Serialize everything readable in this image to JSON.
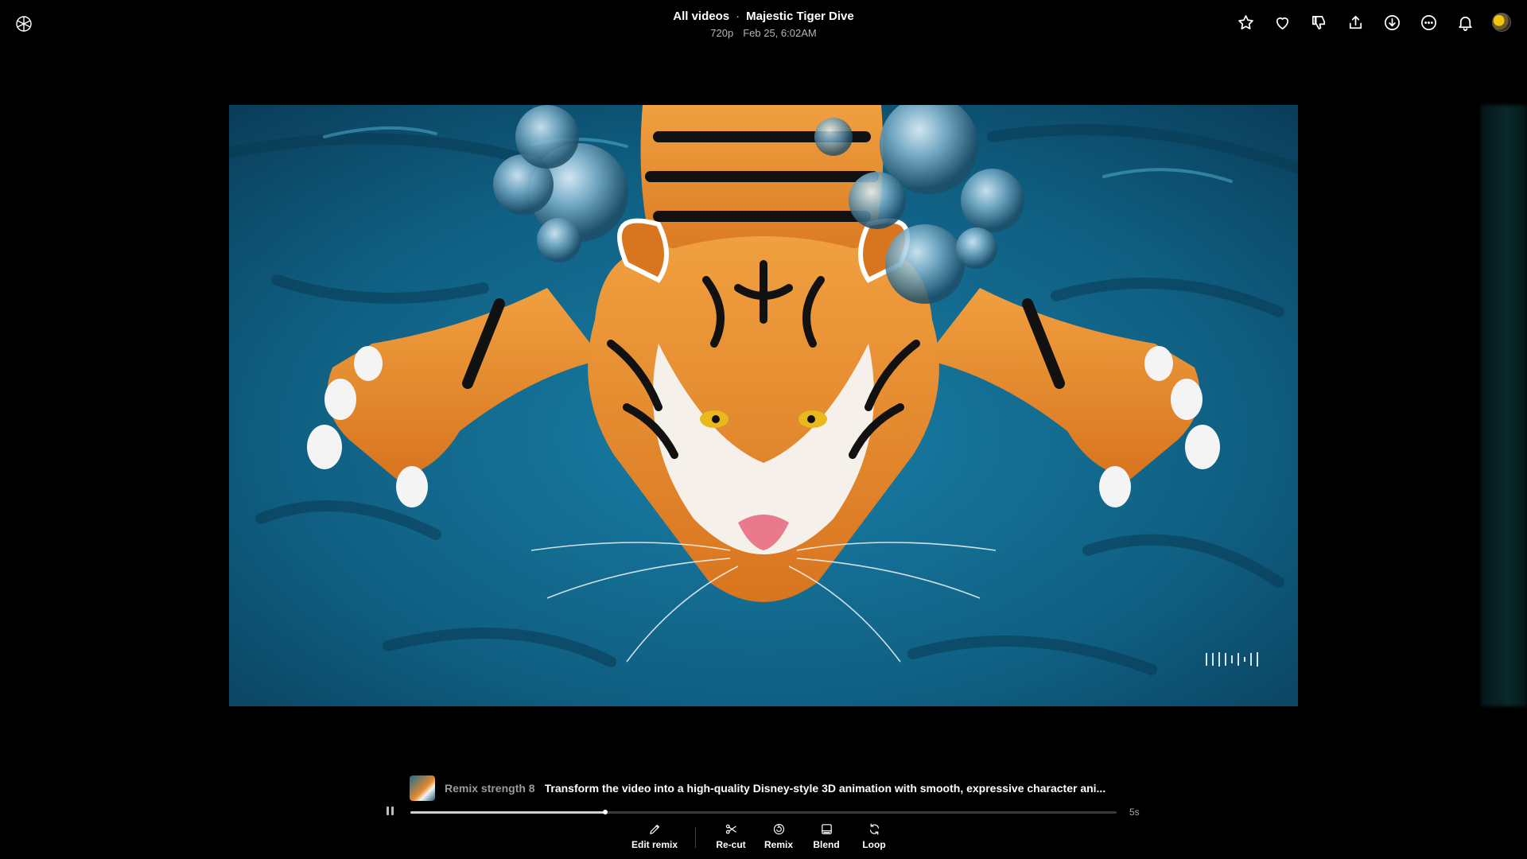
{
  "header": {
    "breadcrumb_root": "All videos",
    "separator": "·",
    "title": "Majestic Tiger Dive",
    "resolution": "720p",
    "timestamp": "Feb 25, 6:02AM"
  },
  "top_actions": [
    {
      "name": "favorite-star-icon"
    },
    {
      "name": "like-heart-icon"
    },
    {
      "name": "dislike-icon"
    },
    {
      "name": "share-icon"
    },
    {
      "name": "download-icon"
    },
    {
      "name": "more-options-icon"
    },
    {
      "name": "notifications-bell-icon"
    }
  ],
  "prompt": {
    "strength_label": "Remix strength 8",
    "text": "Transform the video into a high-quality Disney-style 3D animation with smooth, expressive character ani..."
  },
  "player": {
    "progress_fraction": 0.276,
    "duration": "5s"
  },
  "tools": {
    "edit_remix": "Edit remix",
    "recut": "Re-cut",
    "remix": "Remix",
    "blend": "Blend",
    "loop": "Loop"
  },
  "colors": {
    "background": "#000000",
    "water": "#0f5f82",
    "tiger_orange": "#e8892b"
  }
}
